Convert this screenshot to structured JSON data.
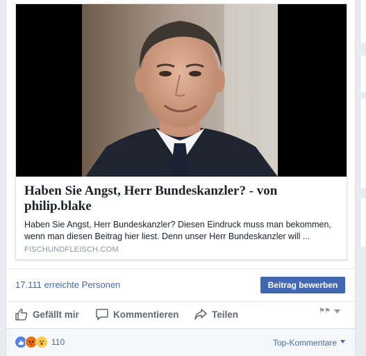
{
  "link_preview": {
    "title": "Haben Sie Angst, Herr Bundeskanzler? - von philip.blake",
    "description": "Haben Sie Angst, Herr Bundeskanzler? Diesen Eindruck muss man bekommen, wenn man diesen Beitrag hier liest. Denn unser Herr Bundeskanzler will ...",
    "domain": "FISCHUNDFLEISCH.COM"
  },
  "insights": {
    "reach": "17.111 erreichte Personen",
    "boost_label": "Beitrag bewerben"
  },
  "actions": {
    "like": "Gefällt mir",
    "comment": "Kommentieren",
    "share": "Teilen"
  },
  "reactions": {
    "count": "110",
    "sort_label": "Top-Kommentare"
  },
  "colors": {
    "brand_blue": "#4267b2",
    "text_gray": "#606770"
  }
}
